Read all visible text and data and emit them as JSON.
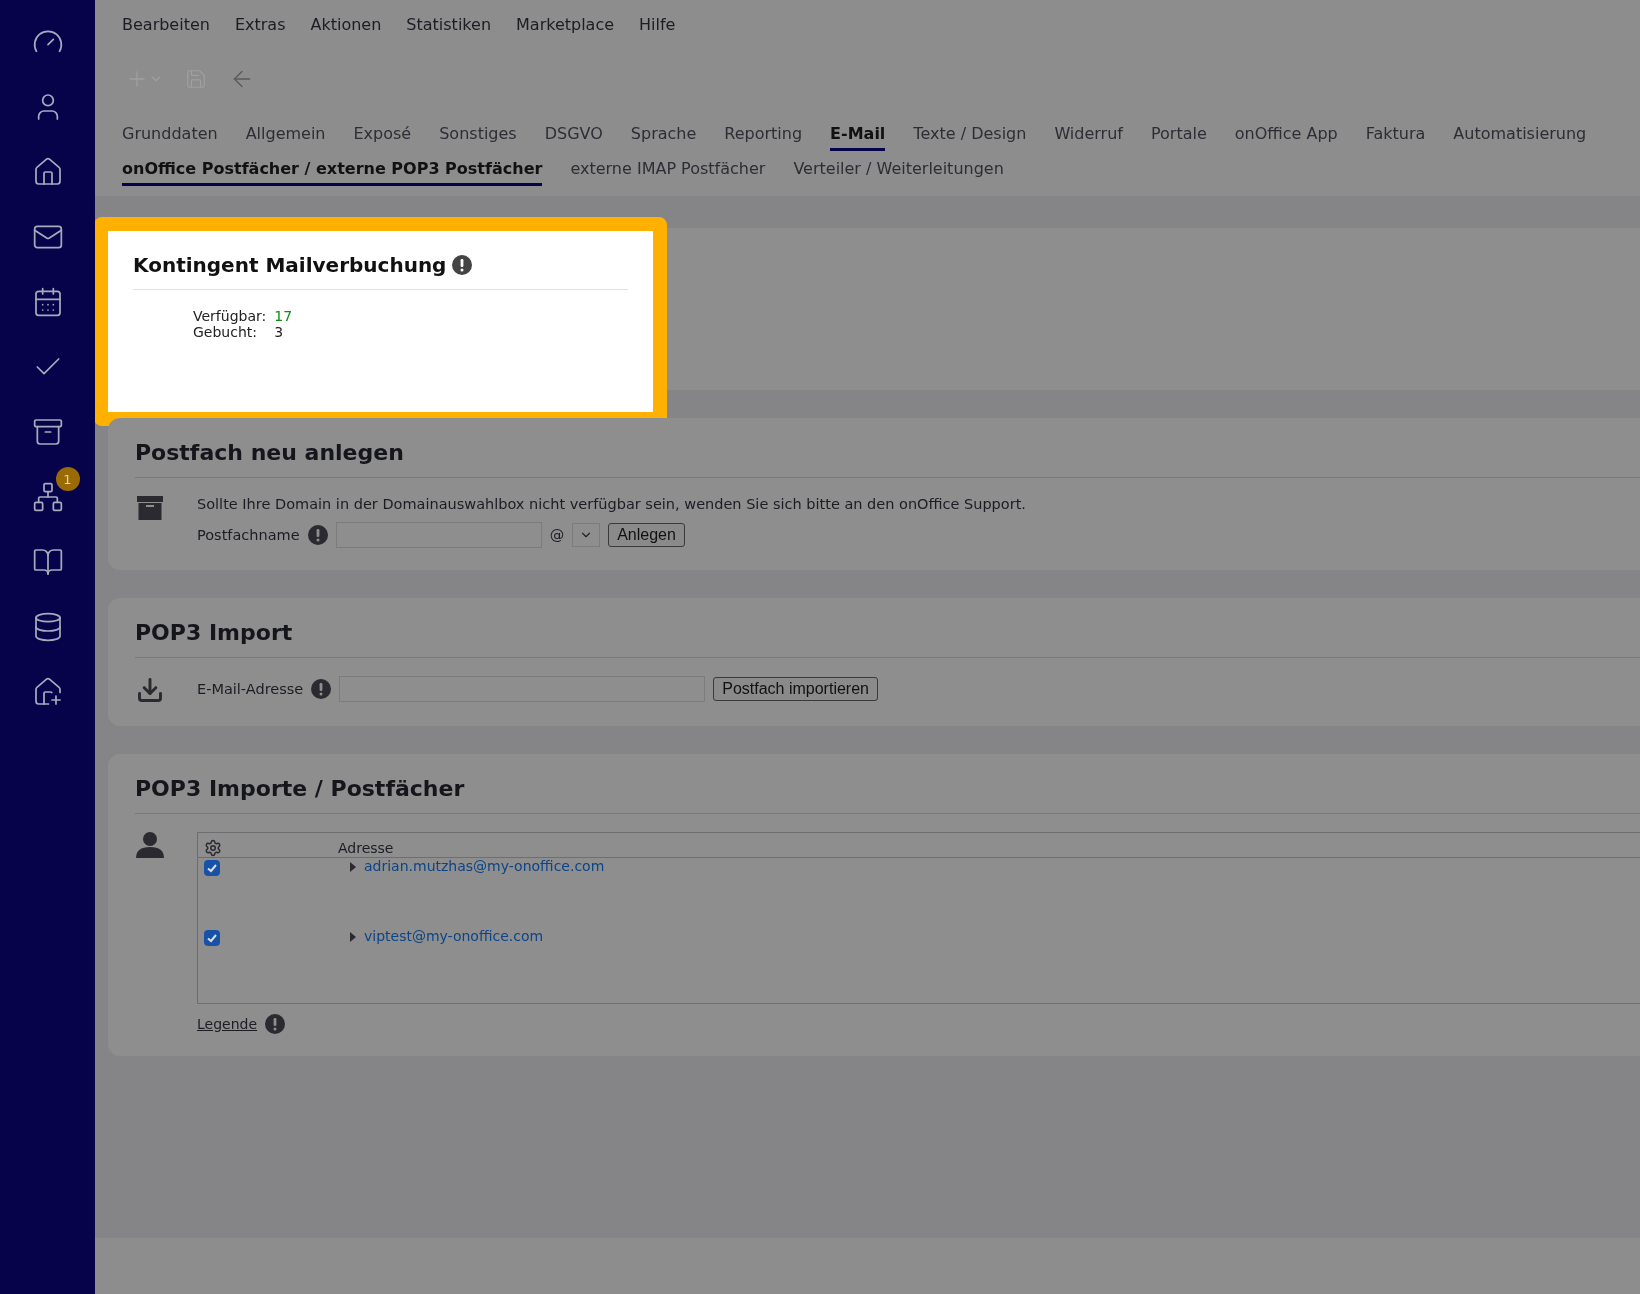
{
  "menu": [
    "Bearbeiten",
    "Extras",
    "Aktionen",
    "Statistiken",
    "Marketplace",
    "Hilfe"
  ],
  "sidebar": {
    "badge": "1"
  },
  "tabs": [
    {
      "label": "Grunddaten",
      "selected": false
    },
    {
      "label": "Allgemein",
      "selected": false
    },
    {
      "label": "Exposé",
      "selected": false
    },
    {
      "label": "Sonstiges",
      "selected": false
    },
    {
      "label": "DSGVO",
      "selected": false
    },
    {
      "label": "Sprache",
      "selected": false
    },
    {
      "label": "Reporting",
      "selected": false
    },
    {
      "label": "E-Mail",
      "selected": true
    },
    {
      "label": "Texte / Design",
      "selected": false
    },
    {
      "label": "Widerruf",
      "selected": false
    },
    {
      "label": "Portale",
      "selected": false
    },
    {
      "label": "onOffice App",
      "selected": false
    },
    {
      "label": "Faktura",
      "selected": false
    },
    {
      "label": "Automatisierung",
      "selected": false
    }
  ],
  "subtabs": [
    {
      "label": "onOffice Postfächer / externe POP3 Postfächer",
      "selected": true
    },
    {
      "label": "externe IMAP Postfächer",
      "selected": false
    },
    {
      "label": "Verteiler / Weiterleitungen",
      "selected": false
    }
  ],
  "quota_card": {
    "title": "Kontingent Mailverbuchung",
    "rows": [
      {
        "label": "Verfügbar:",
        "value": "17",
        "color": "#128a12"
      },
      {
        "label": "Gebucht:",
        "value": "3",
        "color": "#1e1e1e"
      }
    ]
  },
  "new_mailbox": {
    "title": "Postfach neu anlegen",
    "notice": "Sollte Ihre Domain in der Domainauswahlbox nicht verfügbar sein, wenden Sie sich bitte an den onOffice Support.",
    "field_label": "Postfachname",
    "at": "@",
    "button": "Anlegen"
  },
  "pop3_import": {
    "title": "POP3 Import",
    "field_label": "E-Mail-Adresse",
    "button": "Postfach importieren"
  },
  "pop3_list": {
    "title": "POP3 Importe / Postfächer",
    "columns": [
      "Adresse"
    ],
    "rows": [
      {
        "checked": true,
        "address": "adrian.mutzhas@my-onoffice.com"
      },
      {
        "checked": true,
        "address": "viptest@my-onoffice.com"
      }
    ],
    "legend": "Legende"
  }
}
